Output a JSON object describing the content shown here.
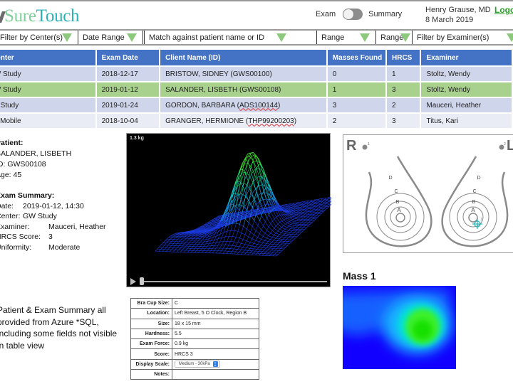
{
  "app": {
    "logo_sure": "Sure",
    "logo_touch": "Touch"
  },
  "header": {
    "toggle_left": "Exam",
    "toggle_right": "Summary",
    "toggle_state": "exam",
    "user_name": "Henry Grause, MD",
    "date": "8 March 2019",
    "logout": "Logout"
  },
  "filters": {
    "center": "Filter by Center(s)",
    "date_range": "Date Range",
    "search_placeholder": "Match against patient name or ID",
    "masses_range": "Range",
    "hrcs_range": "Range",
    "examiner": "Filter by Examiner(s)"
  },
  "table": {
    "columns": [
      "Center",
      "Exam Date",
      "Client Name (ID)",
      "Masses Found",
      "HRCS",
      "Examiner"
    ],
    "rows": [
      {
        "center": "GW Study",
        "date": "2018-12-17",
        "client_name": "BRISTOW, SIDNEY",
        "client_id": "GWS00100",
        "masses": "0",
        "hrcs": "1",
        "examiner": "Stoltz, Wendy",
        "selected": false
      },
      {
        "center": "GW Study",
        "date": "2019-01-12",
        "client_name": "SALANDER, LISBETH",
        "client_id": "GWS00108",
        "masses": "1",
        "hrcs": "3",
        "examiner": "Stoltz, Wendy",
        "selected": true
      },
      {
        "center": "AD Study",
        "date": "2019-01-24",
        "client_name": "GORDON, BARBARA",
        "client_id": "ADS100144",
        "masses": "3",
        "hrcs": "2",
        "examiner": "Mauceri, Heather",
        "selected": false
      },
      {
        "center": "TH Mobile",
        "date": "2018-10-04",
        "client_name": "GRANGER, HERMIONE",
        "client_id": "THP99200203",
        "masses": "2",
        "hrcs": "3",
        "examiner": "Titus, Kari",
        "selected": false
      }
    ]
  },
  "patient": {
    "heading": "Patient:",
    "name": "SALANDER, LISBETH",
    "id_label": "ID:",
    "id": "GWS00108",
    "age_label": "Age:",
    "age": "45"
  },
  "exam_summary": {
    "heading": "Exam Summary:",
    "date_label": "Date:",
    "date": "2019-01-12, 14:30",
    "center_label": "Center:",
    "center": "GW Study",
    "examiner_label": "Examiner:",
    "examiner": "Mauceri, Heather",
    "hrcs_label": "HRCS Score:",
    "hrcs": "3",
    "uniformity_label": "Uniformity:",
    "uniformity": "Moderate"
  },
  "note": "Patient & Exam Summary all provided from Azure *SQL, including some fields not visible in table view",
  "viewer": {
    "force_label": "1.3 kg",
    "playback_progress": 0.01
  },
  "mass_details": {
    "rows": [
      {
        "key": "Bra Cup Size:",
        "value": "C"
      },
      {
        "key": "Location:",
        "value": "Left Breast, 5 O Clock, Region B"
      },
      {
        "key": "Size:",
        "value": "18 x 15 mm"
      },
      {
        "key": "Hardness:",
        "value": "5.5"
      },
      {
        "key": "Exam Force:",
        "value": "0.9 kg"
      },
      {
        "key": "Score:",
        "value": "HRCS 3"
      },
      {
        "key": "Display Scale:",
        "value": "Medium - 30kPa",
        "select": true
      },
      {
        "key": "Notes:",
        "value": ""
      }
    ]
  },
  "diagram": {
    "right_label": "R",
    "left_label": "L",
    "right_marker": "1",
    "left_marker": "2",
    "regions": [
      "A",
      "B",
      "C",
      "D"
    ],
    "mass_marker": "1",
    "mass_color": "#29b3b8"
  },
  "mass_view": {
    "title": "Mass 1"
  },
  "colors": {
    "header_blue": "#4472c4",
    "row_selected": "#a9d18e",
    "filter_triangle": "#8cc97c",
    "logout_green": "#2a9d2a"
  }
}
